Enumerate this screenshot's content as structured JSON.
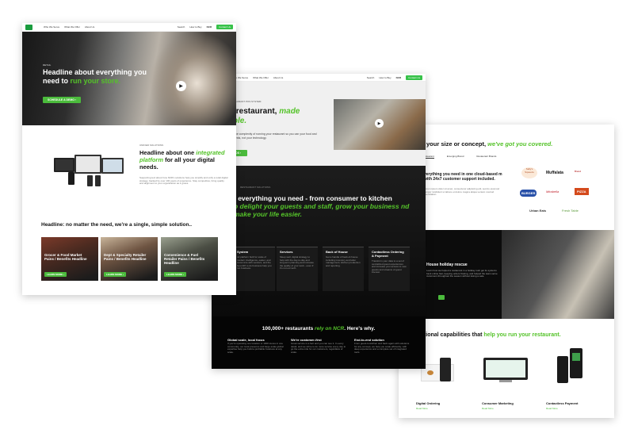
{
  "left_page": {
    "nav": {
      "items": [
        "Who We Serve",
        "What We Offer",
        "About Us"
      ],
      "right": [
        "Search",
        "How to Buy",
        "NCR"
      ],
      "cta": "Contact Us"
    },
    "hero": {
      "eyebrow": "RETAIL",
      "headline_part1": "Headline about everything you need to ",
      "headline_highlight": "run your store.",
      "cta": "SCHEDULE A DEMO"
    },
    "integrated": {
      "eyebrow": "UNIFIED SOLUTIONS",
      "headline_part1": "Headline about one ",
      "headline_highlight": "integrated platform",
      "headline_part2": " for all your digital needs.",
      "body": "Supporting text about how NCR's solutions help you simplify and unify a retail digital strategy, backed by over 100 years of experience. Stay competitive, bring quality and alignment to your organization as it grows."
    },
    "solution_title": "Headline: no matter the need, we're a single, simple solution..",
    "cards": [
      {
        "title": "Grocer & Food Market Pains / Benefits Headline",
        "cta": "LEARN MORE"
      },
      {
        "title": "Dept & Specialty Retailer Pains / Benefits Headline",
        "cta": "LEARN MORE"
      },
      {
        "title": "Convenience & Fuel Retailer Pains / Benefits Headline",
        "cta": "LEARN MORE"
      }
    ]
  },
  "middle_page": {
    "nav": {
      "items": [
        "Who We Serve",
        "What We Offer",
        "About Us"
      ],
      "right": [
        "Search",
        "How to Buy",
        "NCR"
      ],
      "cta": "Contact Us"
    },
    "hero": {
      "eyebrow": "RESTAURANT POS SYSTEM",
      "headline_part1": "ur restaurant, ",
      "headline_highlight": "made",
      "headline_line2_highlight": "mple.",
      "body": "e the complexity of running your restaurant so you can your food and guests, not your technology.",
      "cta": "OS"
    },
    "dark": {
      "eyebrow": "RESTAURANT SOLUTIONS",
      "headline_part1": "t everything you need - from consumer to kitchen",
      "headline_highlight": "o delight your guests and staff, grow your business nd make your life easier."
    },
    "cards": [
      {
        "title": "System",
        "body": "nd platform built for scale of modern intelligence, easier, and customize with vendors, and the best API to do business help you run business."
      },
      {
        "title": "Services",
        "body": "Sleep well, digital strategy to help with the day-to-day and long-term planning and increase the quality of your work - even if it's not our tech."
      },
      {
        "title": "Back of House",
        "body": "Get a handle of back-of-house including inventory and labor management, kitchen production and reporting."
      },
      {
        "title": "Contactless Ordering & Payment",
        "body": "Transform your data to a set of centralized guest experiences and increase your access to new guests and streams of guest interest."
      }
    ],
    "stats": {
      "prefix": "100,000+ restaurants ",
      "highlight": "rely on NCR",
      "suffix": ". Here's why."
    },
    "pillars": [
      {
        "title": "Global scale, local focus",
        "body": "If you're operating one location or 1000 stores in one community, our local presence and large-scale global expertise help you build a profitable business at any scale."
      },
      {
        "title": "We're customer-first",
        "body": "Great service is a fact and you can see it. In every detail, and we strive to do more service every day to go the extra mile for our customers, regardless of scale."
      },
      {
        "title": "End-to-end solution",
        "body": "From guest-to-kitchen and back again with solutions for any concept, we help you scale efficiently, with deep experience and a complete set of integrated tools."
      }
    ]
  },
  "right_page": {
    "headline_part1": "matter your size or concept, ",
    "headline_highlight": "we've got you covered.",
    "tabs": [
      "Restaurant",
      "Emerging Brand",
      "Restaurant Brands"
    ],
    "cloud": "verything you need in one cloud-based m with 24x7 customer support included.",
    "cloud_body": "Lorem ipsum dolor sit amet, consectetur adipiscing elit, sed do eiusmod tempor incididunt ut labore et dolore magna aliqua veniam nostrud exercitation.",
    "logos": [
      "Sally's Squeeze",
      "Muffalata",
      "Brand",
      "BURGER",
      "Mirabella",
      "PIZZA",
      "Urban Eats",
      "Fresh Table"
    ],
    "holiday": {
      "title": "House holiday rescue",
      "body": "Learn how we helped a restaurant in a holiday rush get its systems back online fast, keeping orders flowing, and helped the team serve customers throughout the season without losing a sale.",
      "cta": ""
    },
    "capabilities_part1": "itional capabilities that ",
    "capabilities_highlight": "help you run your restaurant.",
    "capabilities": [
      {
        "title": "Digital Ordering",
        "link": "Read More"
      },
      {
        "title": "Consumer Marketing",
        "link": "Read More"
      },
      {
        "title": "Contactless Payment",
        "link": "Read More"
      }
    ]
  },
  "colors": {
    "accent": "#4bbb3c",
    "dark": "#111111"
  }
}
